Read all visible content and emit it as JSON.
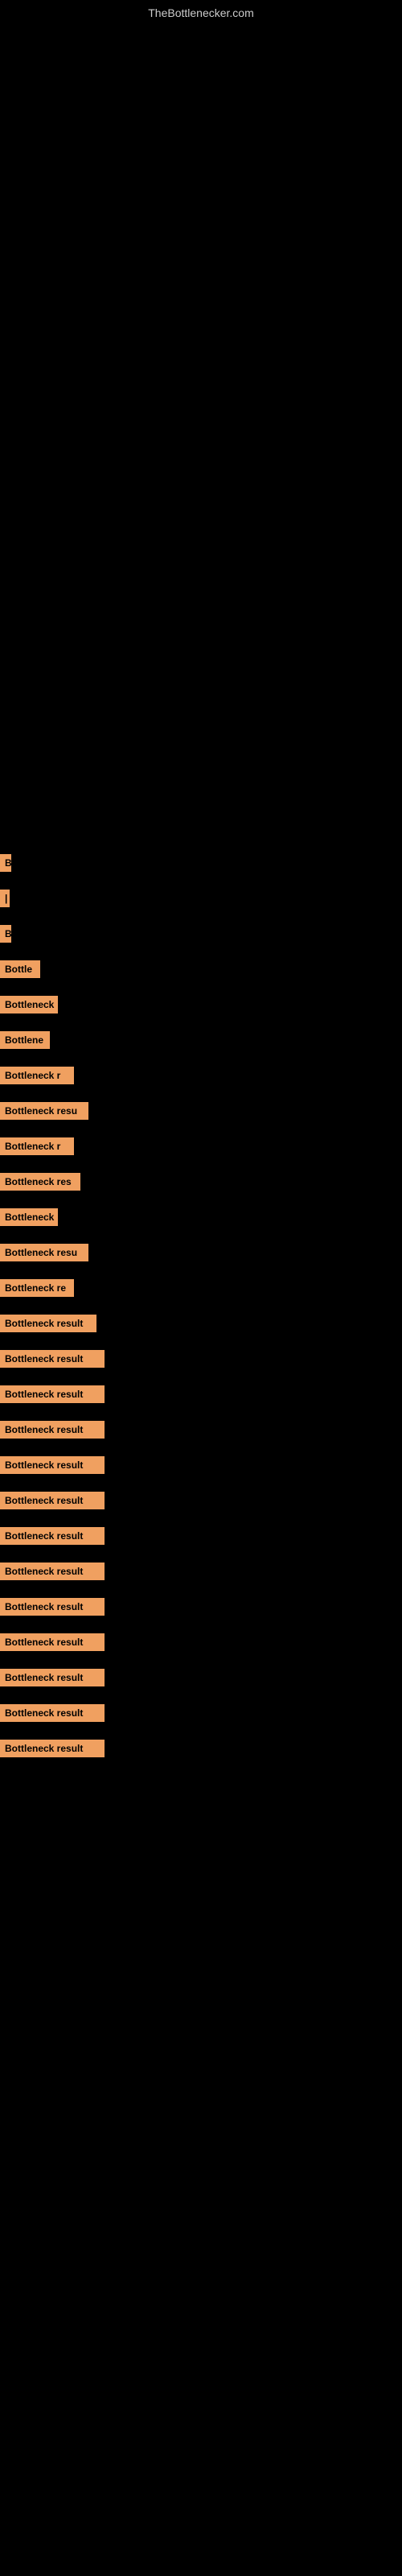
{
  "site": {
    "title": "TheBottlenecker.com"
  },
  "items": [
    {
      "id": 1,
      "label": "B",
      "class": "item-1"
    },
    {
      "id": 2,
      "label": "|",
      "class": "item-2"
    },
    {
      "id": 3,
      "label": "B",
      "class": "item-3"
    },
    {
      "id": 4,
      "label": "Bottle",
      "class": "item-4"
    },
    {
      "id": 5,
      "label": "Bottleneck",
      "class": "item-5"
    },
    {
      "id": 6,
      "label": "Bottlene",
      "class": "item-6"
    },
    {
      "id": 7,
      "label": "Bottleneck r",
      "class": "item-7"
    },
    {
      "id": 8,
      "label": "Bottleneck resu",
      "class": "item-8"
    },
    {
      "id": 9,
      "label": "Bottleneck r",
      "class": "item-9"
    },
    {
      "id": 10,
      "label": "Bottleneck res",
      "class": "item-10"
    },
    {
      "id": 11,
      "label": "Bottleneck",
      "class": "item-11"
    },
    {
      "id": 12,
      "label": "Bottleneck resu",
      "class": "item-12"
    },
    {
      "id": 13,
      "label": "Bottleneck re",
      "class": "item-13"
    },
    {
      "id": 14,
      "label": "Bottleneck result",
      "class": "item-14"
    },
    {
      "id": 15,
      "label": "Bottleneck result",
      "class": "item-15"
    },
    {
      "id": 16,
      "label": "Bottleneck result",
      "class": "item-16"
    },
    {
      "id": 17,
      "label": "Bottleneck result",
      "class": "item-17"
    },
    {
      "id": 18,
      "label": "Bottleneck result",
      "class": "item-18"
    },
    {
      "id": 19,
      "label": "Bottleneck result",
      "class": "item-19"
    },
    {
      "id": 20,
      "label": "Bottleneck result",
      "class": "item-20"
    },
    {
      "id": 21,
      "label": "Bottleneck result",
      "class": "item-21"
    },
    {
      "id": 22,
      "label": "Bottleneck result",
      "class": "item-22"
    },
    {
      "id": 23,
      "label": "Bottleneck result",
      "class": "item-23"
    },
    {
      "id": 24,
      "label": "Bottleneck result",
      "class": "item-24"
    },
    {
      "id": 25,
      "label": "Bottleneck result",
      "class": "item-25"
    },
    {
      "id": 26,
      "label": "Bottleneck result",
      "class": "item-26"
    }
  ],
  "accent_color": "#f0a060"
}
